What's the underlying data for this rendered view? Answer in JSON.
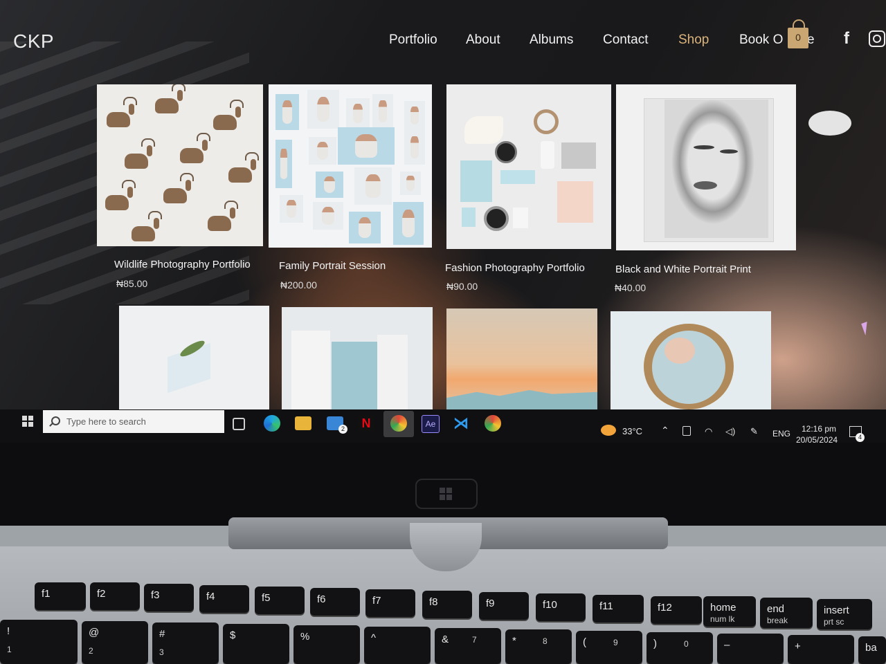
{
  "header": {
    "logo": "CKP",
    "nav": [
      "Portfolio",
      "About",
      "Albums",
      "Contact",
      "Shop",
      "Book O"
    ],
    "nav_tail": "e",
    "cart_count": "0",
    "social": [
      "facebook-icon",
      "instagram-icon"
    ],
    "accent_color": "#dbb47c"
  },
  "products": [
    {
      "name": "Wildlife Photography Portfolio",
      "price": "₦85.00"
    },
    {
      "name": "Family Portrait Session",
      "price": "₦200.00"
    },
    {
      "name": "Fashion Photography Portfolio",
      "price": "₦90.00"
    },
    {
      "name": "Black and White Portrait Print",
      "price": "₦40.00"
    }
  ],
  "taskbar": {
    "search_placeholder": "Type here to search",
    "mail_badge": "2",
    "weather": "33°C",
    "language": "ENG",
    "time": "12:16 pm",
    "date": "20/05/2024",
    "notification_count": "4",
    "apps": [
      "task-view-icon",
      "edge-icon",
      "file-explorer-icon",
      "mail-icon",
      "netflix-icon",
      "chrome-profile-icon",
      "after-effects-icon",
      "vscode-icon",
      "chrome-icon"
    ]
  },
  "keyboard": {
    "fn_keys": [
      "f1",
      "f2",
      "f3",
      "f4",
      "f5",
      "f6",
      "f7",
      "f8",
      "f9",
      "f10",
      "f11",
      "f12"
    ],
    "home": "home",
    "home_sub": "num lk",
    "end": "end",
    "end_sub": "break",
    "insert": "insert",
    "insert_sub": "prt sc",
    "number_row": [
      "!",
      "1",
      "@",
      "2",
      "#",
      "3",
      "$",
      "%",
      "^",
      "&",
      "7",
      "*",
      "8",
      "(",
      "9",
      ")",
      "0",
      "–",
      "+",
      "ba"
    ]
  }
}
